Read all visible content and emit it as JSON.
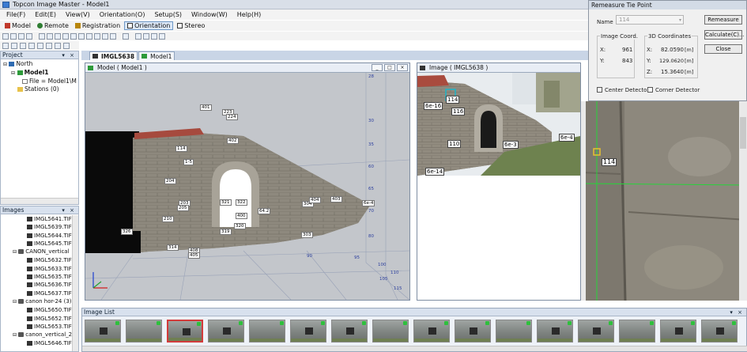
{
  "window": {
    "title": "Topcon Image Master - Model1"
  },
  "menu": [
    "File(F)",
    "Edit(E)",
    "View(V)",
    "Orientation(O)",
    "Setup(S)",
    "Window(W)",
    "Help(H)"
  ],
  "modes": [
    "Model",
    "Remote",
    "Registration",
    "Orientation",
    "Stereo"
  ],
  "active_mode": "Orientation",
  "project_panel": {
    "title": "Project",
    "tree": [
      "North",
      "Model1",
      "File = Model1\\M",
      "Stations (0)"
    ]
  },
  "images_panel": {
    "title": "Images",
    "items": [
      "IMGL5641.TIF",
      "IMGL5639.TIF",
      "IMGL5644.TIF",
      "IMGL5645.TIF",
      "CANON_vertical",
      "IMGL5632.TIF",
      "IMGL5633.TIF",
      "IMGL5635.TIF",
      "IMGL5636.TIF",
      "IMGL5637.TIF",
      "canon hor-24 (3)",
      "IMGL5650.TIF",
      "IMGL5652.TIF",
      "IMGL5653.TIF",
      "canon_vertical_2",
      "IMGL5646.TIF"
    ]
  },
  "doc_tabs": [
    "IMGL5638",
    "Model1"
  ],
  "model_view": {
    "title": "Model ( Model1 )",
    "point_labels": [
      "401",
      "223",
      "224",
      "402",
      "114",
      "1-5",
      "204",
      "203",
      "205",
      "210",
      "321",
      "322",
      "400",
      "320",
      "319",
      "64.2",
      "304",
      "404",
      "403",
      "6e-4",
      "303",
      "326",
      "314",
      "408",
      "405"
    ],
    "grid_labels": [
      "28",
      "30",
      "35",
      "60",
      "65",
      "70",
      "80",
      "90",
      "95",
      "100",
      "105",
      "110",
      "115"
    ]
  },
  "image_view": {
    "title": "Image ( IMGL5638 )",
    "point_labels": [
      "114",
      "6e-16",
      "116",
      "110",
      "6e-3",
      "6e-4",
      "6e-14"
    ]
  },
  "zoom_view": {
    "point_label": "114"
  },
  "dialog": {
    "title": "Remeasure Tie Point",
    "name_label": "Name",
    "name_value": "114",
    "image_coord_title": "Image Coord.",
    "x_label": "X:",
    "y_label": "Y:",
    "z_label": "Z:",
    "img_x": "961",
    "img_y": "843",
    "coords_title": "3D Coordinates",
    "x3d": "82.0590",
    "y3d": "129.0620",
    "z3d": "15.3640",
    "unit": "[m]",
    "remeasure": "Remeasure",
    "calculate": "Calculate(C)...",
    "close": "Close",
    "center_detector": "Center Detector",
    "corner_detector": "Corner Detector"
  },
  "image_list": {
    "title": "Image List",
    "count": 16,
    "selected_index": 2
  }
}
